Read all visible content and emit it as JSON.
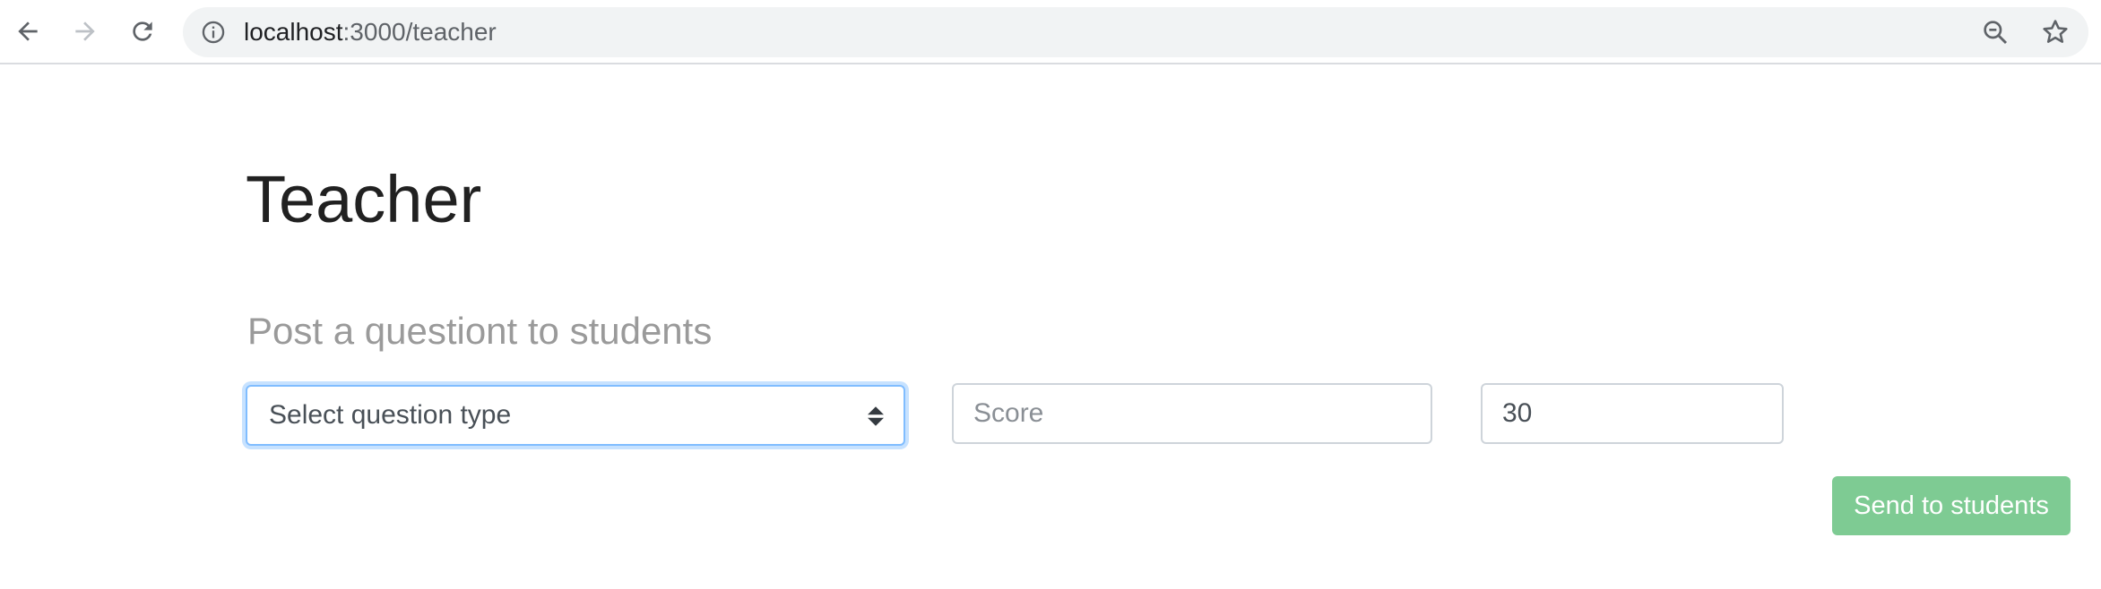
{
  "browser": {
    "url_host": "localhost",
    "url_path": ":3000/teacher",
    "nav": {
      "back_icon": "arrow-left-icon",
      "forward_icon": "arrow-right-icon",
      "reload_icon": "reload-icon"
    },
    "omnibox_icons": [
      "info-icon",
      "zoom-out-icon",
      "star-icon"
    ]
  },
  "page": {
    "title": "Teacher",
    "section_heading": "Post a questiont to students"
  },
  "form": {
    "question_type": {
      "selected_label": "Select question type"
    },
    "score": {
      "value": "",
      "placeholder": "Score"
    },
    "time": {
      "value": "30",
      "placeholder": ""
    },
    "send_label": "Send to students"
  },
  "colors": {
    "send_button_bg": "#7ecb93",
    "select_focus_border": "#80bdff",
    "heading_gray": "#9a9a9a"
  }
}
